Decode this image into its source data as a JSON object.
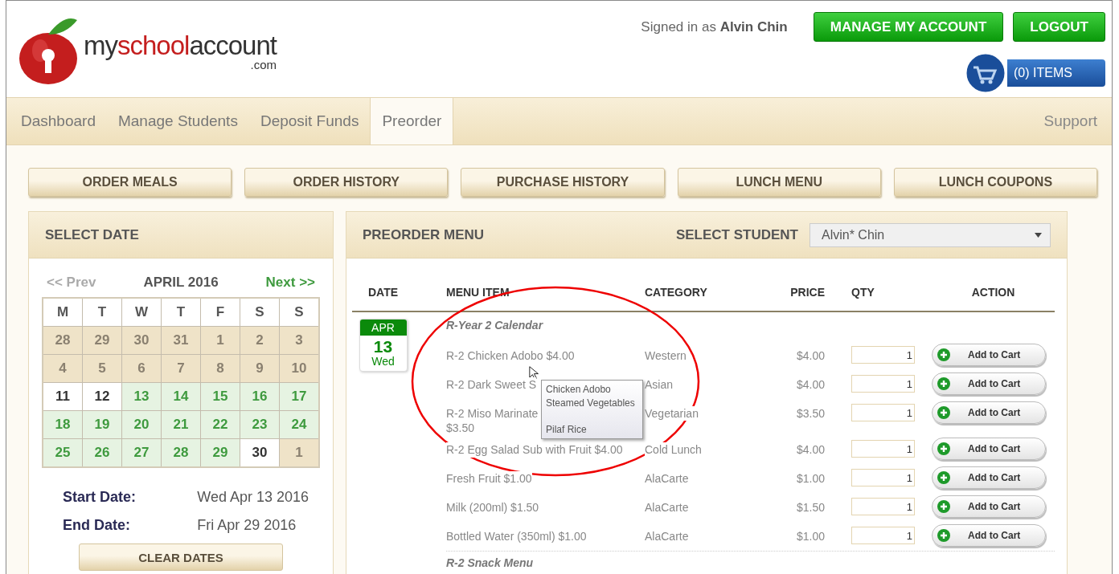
{
  "logo": {
    "prefix": "my",
    "highlight": "school",
    "suffix": "account",
    "domain": ".com"
  },
  "signed_in": "Signed in as **Alvin Chin**",
  "header_buttons": [
    "MANAGE MY ACCOUNT",
    "LOGOUT"
  ],
  "cart": {
    "label": "(0) ITEMS"
  },
  "nav": [
    {
      "label": "Dashboard",
      "selected": false
    },
    {
      "label": "Manage Students",
      "selected": false
    },
    {
      "label": "Deposit Funds",
      "selected": false
    },
    {
      "label": "Preorder",
      "selected": true
    }
  ],
  "nav_right": "Support",
  "action_buttons": [
    "ORDER MEALS",
    "ORDER HISTORY",
    "PURCHASE HISTORY",
    "LUNCH MENU",
    "LUNCH COUPONS"
  ],
  "select_date": {
    "title": "SELECT DATE",
    "prev": "<< Prev",
    "month": "APRIL 2016",
    "next": "Next >>",
    "weekdays": [
      "M",
      "T",
      "W",
      "T",
      "F",
      "S",
      "S"
    ],
    "weeks": [
      [
        {
          "day": "28",
          "kind": "other"
        },
        {
          "day": "29",
          "kind": "other"
        },
        {
          "day": "30",
          "kind": "other"
        },
        {
          "day": "31",
          "kind": "other"
        },
        {
          "day": "1",
          "kind": "other"
        },
        {
          "day": "2",
          "kind": "other"
        },
        {
          "day": "3",
          "kind": "other"
        }
      ],
      [
        {
          "day": "4",
          "kind": "other"
        },
        {
          "day": "5",
          "kind": "other"
        },
        {
          "day": "6",
          "kind": "other"
        },
        {
          "day": "7",
          "kind": "other"
        },
        {
          "day": "8",
          "kind": "other"
        },
        {
          "day": "9",
          "kind": "other"
        },
        {
          "day": "10",
          "kind": "other"
        }
      ],
      [
        {
          "day": "11",
          "kind": "plain"
        },
        {
          "day": "12",
          "kind": "plain"
        },
        {
          "day": "13",
          "kind": "available"
        },
        {
          "day": "14",
          "kind": "available"
        },
        {
          "day": "15",
          "kind": "available"
        },
        {
          "day": "16",
          "kind": "available"
        },
        {
          "day": "17",
          "kind": "available"
        }
      ],
      [
        {
          "day": "18",
          "kind": "available"
        },
        {
          "day": "19",
          "kind": "available"
        },
        {
          "day": "20",
          "kind": "available"
        },
        {
          "day": "21",
          "kind": "available"
        },
        {
          "day": "22",
          "kind": "available"
        },
        {
          "day": "23",
          "kind": "available"
        },
        {
          "day": "24",
          "kind": "available"
        }
      ],
      [
        {
          "day": "25",
          "kind": "available"
        },
        {
          "day": "26",
          "kind": "available"
        },
        {
          "day": "27",
          "kind": "available"
        },
        {
          "day": "28",
          "kind": "available"
        },
        {
          "day": "29",
          "kind": "available"
        },
        {
          "day": "30",
          "kind": "plain"
        },
        {
          "day": "1",
          "kind": "other"
        }
      ]
    ],
    "start_label": "Start Date:",
    "start_value": "Wed Apr 13 2016",
    "end_label": "End Date:",
    "end_value": "Fri Apr 29 2016",
    "clear": "CLEAR DATES"
  },
  "preorder": {
    "title": "PREORDER MENU",
    "student_label": "SELECT STUDENT",
    "student_value": "Alvin* Chin",
    "columns": [
      "DATE",
      "MENU ITEM",
      "CATEGORY",
      "PRICE",
      "QTY",
      "ACTION"
    ],
    "date": {
      "month": "APR",
      "day": "13",
      "weekday": "Wed"
    },
    "groups": [
      {
        "title": "R-Year 2 Calendar",
        "items": [
          {
            "name": "R-2 Chicken Adobo $4.00",
            "category": "Western",
            "price": "$4.00",
            "qty": "1",
            "action": "Add to Cart"
          },
          {
            "name": "R-2 Dark Sweet S",
            "category": "Asian",
            "price": "$4.00",
            "qty": "1",
            "action": "Add to Cart"
          },
          {
            "name": "R-2 Miso Marinate\n$3.50",
            "category": "Vegetarian",
            "price": "$3.50",
            "qty": "1",
            "action": "Add to Cart"
          },
          {
            "name": "R-2 Egg Salad Sub with Fruit $4.00",
            "category": "Cold Lunch",
            "price": "$4.00",
            "qty": "1",
            "action": "Add to Cart"
          },
          {
            "name": "Fresh Fruit $1.00",
            "category": "AlaCarte",
            "price": "$1.00",
            "qty": "1",
            "action": "Add to Cart"
          },
          {
            "name": "Milk (200ml) $1.50",
            "category": "AlaCarte",
            "price": "$1.50",
            "qty": "1",
            "action": "Add to Cart"
          },
          {
            "name": "Bottled Water (350ml) $1.00",
            "category": "AlaCarte",
            "price": "$1.00",
            "qty": "1",
            "action": "Add to Cart"
          }
        ]
      },
      {
        "title": "R-2 Snack Menu"
      }
    ]
  },
  "tooltip": {
    "lines": [
      {
        "text": "Chicken Adobo",
        "spaced": false
      },
      {
        "text": "Steamed Vegetables",
        "spaced": false
      },
      {
        "text": "Pilaf Rice",
        "spaced": true
      }
    ]
  }
}
